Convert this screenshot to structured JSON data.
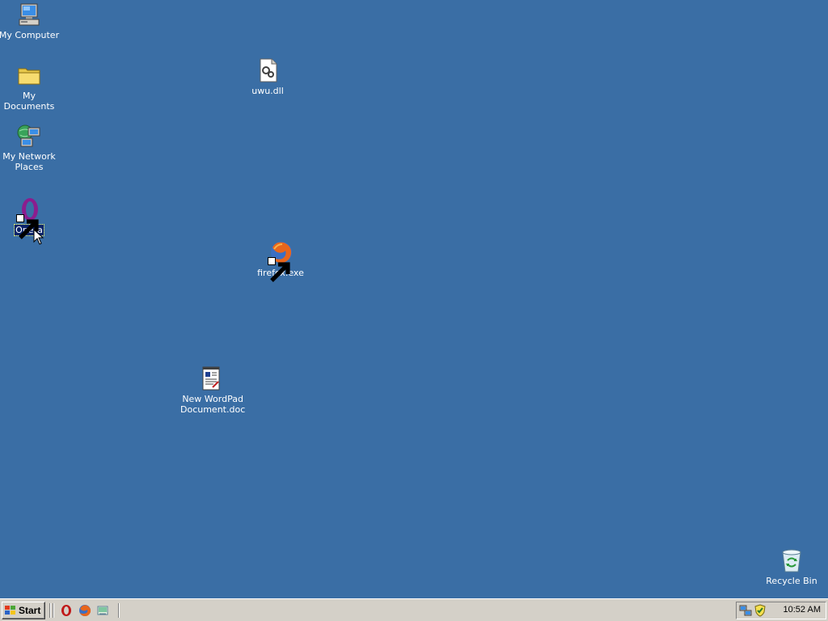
{
  "desktop": {
    "background_color": "#3a6ea5",
    "icons": [
      {
        "label": "My Computer",
        "icon": "computer-icon"
      },
      {
        "label": "My Documents",
        "icon": "folder-icon"
      },
      {
        "label": "My Network Places",
        "icon": "network-icon"
      },
      {
        "label": "Opera",
        "icon": "opera-icon",
        "selected": true,
        "shortcut": true
      },
      {
        "label": "uwu.dll",
        "icon": "dll-file-icon"
      },
      {
        "label": "firefox.exe",
        "icon": "firefox-icon",
        "shortcut": true
      },
      {
        "label": "New WordPad Document.doc",
        "icon": "wordpad-document-icon"
      },
      {
        "label": "Recycle Bin",
        "icon": "recycle-bin-icon"
      }
    ]
  },
  "taskbar": {
    "start_label": "Start",
    "quick_launch": [
      {
        "icon": "opera-icon"
      },
      {
        "icon": "firefox-icon"
      },
      {
        "icon": "show-desktop-icon"
      }
    ],
    "tray": {
      "icons": [
        {
          "icon": "network-connection-icon"
        },
        {
          "icon": "security-shield-icon"
        }
      ],
      "clock": "10:52 AM"
    }
  }
}
